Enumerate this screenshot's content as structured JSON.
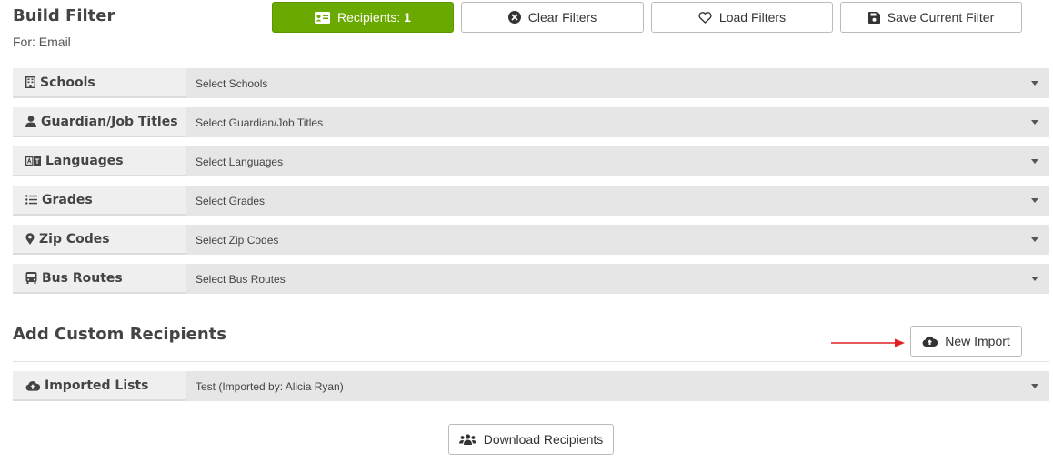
{
  "header": {
    "title": "Build Filter",
    "subtitle": "For: Email"
  },
  "toolbar": {
    "recipients_label": "Recipients:",
    "recipients_count": "1",
    "clear_label": "Clear Filters",
    "load_label": "Load Filters",
    "save_label": "Save Current Filter"
  },
  "filters": [
    {
      "label": "Schools",
      "placeholder": "Select Schools",
      "icon": "building-icon"
    },
    {
      "label": "Guardian/Job Titles",
      "placeholder": "Select Guardian/Job Titles",
      "icon": "user-icon"
    },
    {
      "label": "Languages",
      "placeholder": "Select Languages",
      "icon": "language-icon"
    },
    {
      "label": "Grades",
      "placeholder": "Select Grades",
      "icon": "list-icon"
    },
    {
      "label": "Zip Codes",
      "placeholder": "Select Zip Codes",
      "icon": "map-marker-icon"
    },
    {
      "label": "Bus Routes",
      "placeholder": "Select Bus Routes",
      "icon": "bus-icon"
    }
  ],
  "custom": {
    "title": "Add Custom Recipients",
    "new_import_label": "New Import",
    "imported_label": "Imported Lists",
    "imported_value": "Test (Imported by: Alicia Ryan)"
  },
  "download": {
    "label": "Download Recipients"
  },
  "colors": {
    "accent": "#6aaa00",
    "arrow": "#e02020"
  }
}
